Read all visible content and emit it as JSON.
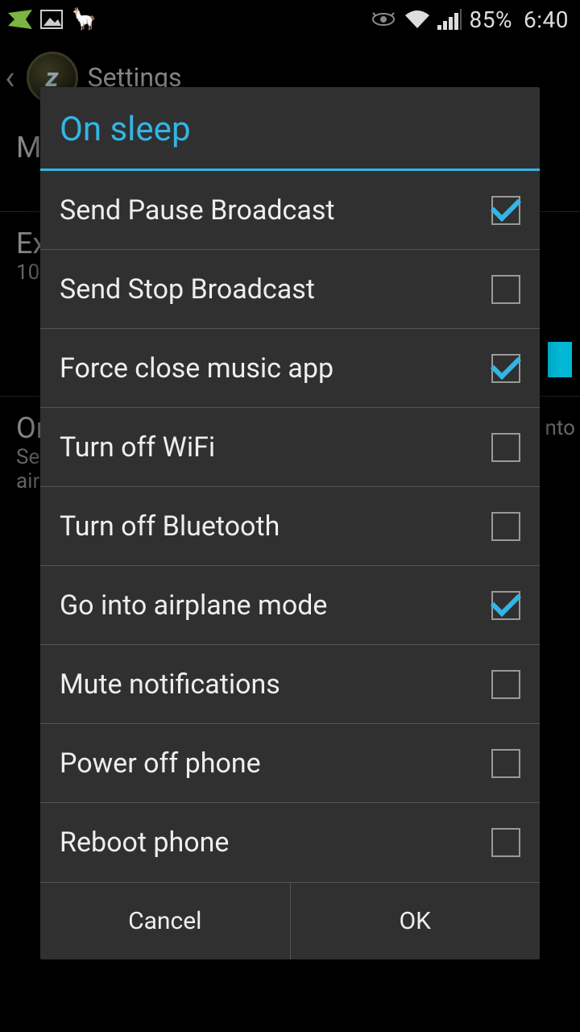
{
  "status_bar": {
    "battery_percent": "85%",
    "clock": "6:40"
  },
  "action_bar": {
    "title": "Settings",
    "icon_letter": "z"
  },
  "background": {
    "row1_header": "M",
    "row2_header": "Ex",
    "row2_sub": "10",
    "row3_header": "On",
    "row3_sub1": "Se",
    "row3_sub2": "air",
    "row3_right": "nto"
  },
  "dialog": {
    "title": "On sleep",
    "options": [
      {
        "label": "Send Pause Broadcast",
        "checked": true
      },
      {
        "label": "Send Stop Broadcast",
        "checked": false
      },
      {
        "label": "Force close music app",
        "checked": true
      },
      {
        "label": "Turn off WiFi",
        "checked": false
      },
      {
        "label": "Turn off Bluetooth",
        "checked": false
      },
      {
        "label": "Go into airplane mode",
        "checked": true
      },
      {
        "label": "Mute notifications",
        "checked": false
      },
      {
        "label": "Power off phone",
        "checked": false
      },
      {
        "label": "Reboot phone",
        "checked": false
      }
    ],
    "cancel_label": "Cancel",
    "ok_label": "OK"
  }
}
